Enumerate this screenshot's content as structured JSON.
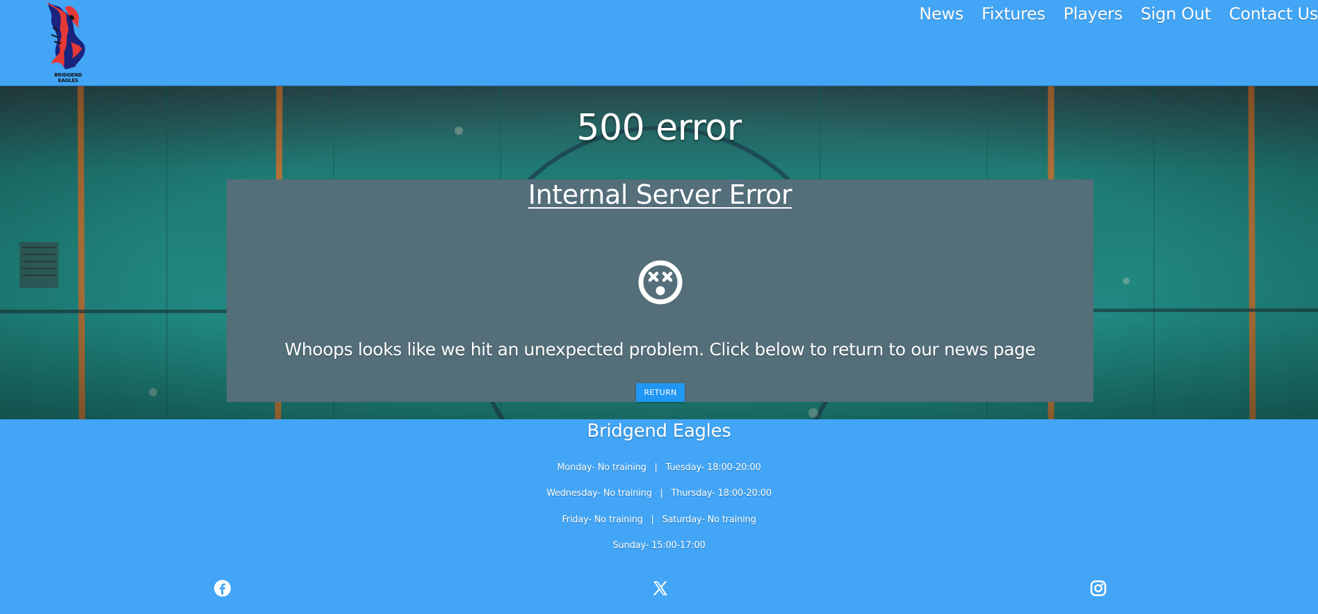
{
  "header": {
    "logo_text": "BRIDGEND EAGLES",
    "nav": [
      {
        "label": "News"
      },
      {
        "label": "Fixtures"
      },
      {
        "label": "Players"
      },
      {
        "label": "Sign Out"
      },
      {
        "label": "Contact Us"
      }
    ]
  },
  "hero": {
    "title": "500 error",
    "panel": {
      "heading": "Internal Server Error",
      "icon": "dizzy-face-icon",
      "message": "Whoops looks like we hit an unexpected problem. Click below to return to our news page",
      "button_label": "RETURN"
    }
  },
  "footer": {
    "title": "Bridgend Eagles",
    "hours": [
      "Monday- No training   |   Tuesday- 18:00-20:00",
      "Wednesday- No training   |   Thursday- 18:00-20:00",
      "Friday- No training   |   Saturday- No training",
      "Sunday- 15:00-17:00"
    ],
    "social": [
      "facebook-icon",
      "x-twitter-icon",
      "instagram-icon"
    ]
  },
  "colors": {
    "header_bg": "#42a5f5",
    "panel_bg": "#546e7a",
    "button_bg": "#2196f3",
    "logo_red": "#e53935",
    "logo_dark": "#1a237e"
  }
}
